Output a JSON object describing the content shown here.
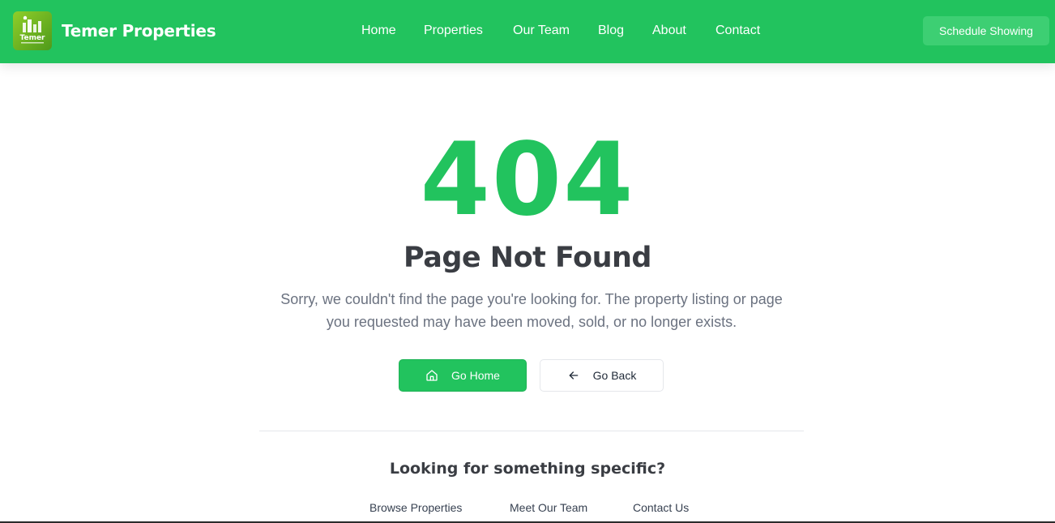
{
  "header": {
    "brand": "Temer Properties",
    "logo_text": "Temer",
    "nav": [
      {
        "label": "Home"
      },
      {
        "label": "Properties"
      },
      {
        "label": "Our Team"
      },
      {
        "label": "Blog"
      },
      {
        "label": "About"
      },
      {
        "label": "Contact"
      }
    ],
    "cta_label": "Schedule Showing"
  },
  "error": {
    "code": "404",
    "title": "Page Not Found",
    "message": "Sorry, we couldn't find the page you're looking for. The property listing or page you requested may have been moved, sold, or no longer exists."
  },
  "actions": {
    "home_label": "Go Home",
    "back_label": "Go Back"
  },
  "suggestions": {
    "title": "Looking for something specific?",
    "links": [
      "Browse Properties",
      "Meet Our Team",
      "Contact Us"
    ]
  },
  "colors": {
    "brand_green": "#22c35e",
    "heading": "#3a3d43",
    "muted": "#6b7280"
  },
  "icons": {
    "home_button": "home-icon",
    "back_button": "arrow-left-icon"
  }
}
